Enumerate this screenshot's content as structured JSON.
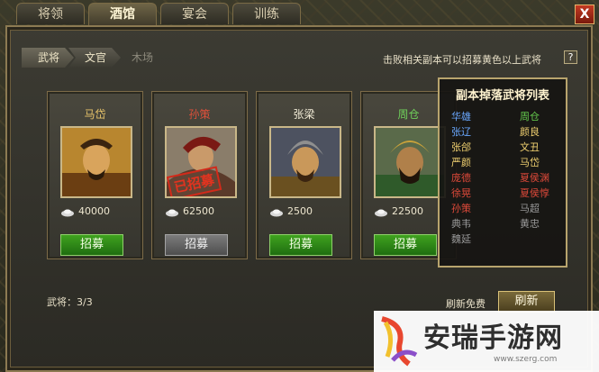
{
  "tabs": [
    {
      "label": "将领",
      "active": false
    },
    {
      "label": "酒馆",
      "active": true
    },
    {
      "label": "宴会",
      "active": false
    },
    {
      "label": "训练",
      "active": false
    }
  ],
  "close_label": "X",
  "breadcrumb": [
    "武将",
    "文官",
    "木场"
  ],
  "hint": "击败相关副本可以招募黄色以上武将",
  "help_label": "?",
  "cards": [
    {
      "name": "马岱",
      "name_color": "#e8c46a",
      "cost": "40000",
      "button": "招募",
      "button_state": "enabled",
      "stamp": ""
    },
    {
      "name": "孙策",
      "name_color": "#e0503a",
      "cost": "62500",
      "button": "招募",
      "button_state": "disabled",
      "stamp": "已招募"
    },
    {
      "name": "张梁",
      "name_color": "#f0ead5",
      "cost": "2500",
      "button": "招募",
      "button_state": "enabled",
      "stamp": ""
    },
    {
      "name": "周仓",
      "name_color": "#6fd05a",
      "cost": "22500",
      "button": "招募",
      "button_state": "enabled",
      "stamp": ""
    }
  ],
  "droplist": {
    "title": "副本掉落武将列表",
    "rows": [
      [
        {
          "name": "华雄",
          "color": "#6aa8ff"
        },
        {
          "name": "周仓",
          "color": "#67d04f"
        }
      ],
      [
        {
          "name": "张辽",
          "color": "#6aa8ff"
        },
        {
          "name": "颜良",
          "color": "#f0d070"
        }
      ],
      [
        {
          "name": "张郃",
          "color": "#f0d070"
        },
        {
          "name": "文丑",
          "color": "#f0d070"
        }
      ],
      [
        {
          "name": "严颜",
          "color": "#f0d070"
        },
        {
          "name": "马岱",
          "color": "#f0d070"
        }
      ],
      [
        {
          "name": "庞德",
          "color": "#e04a3a"
        },
        {
          "name": "夏侯渊",
          "color": "#e04a3a"
        }
      ],
      [
        {
          "name": "徐晃",
          "color": "#e04a3a"
        },
        {
          "name": "夏侯惇",
          "color": "#e04a3a"
        }
      ],
      [
        {
          "name": "孙策",
          "color": "#e04a3a"
        },
        {
          "name": "马超",
          "color": "#9a9a9a"
        }
      ],
      [
        {
          "name": "典韦",
          "color": "#9a9a9a"
        },
        {
          "name": "黄忠",
          "color": "#9a9a9a"
        }
      ],
      [
        {
          "name": "魏延",
          "color": "#9a9a9a"
        },
        {
          "name": "",
          "color": "#9a9a9a"
        }
      ]
    ]
  },
  "general_count": "武将：3/3",
  "refresh_label": "刷新免费",
  "refresh_button": "刷新",
  "watermark": {
    "text": "安瑞手游网",
    "url": "www.szerg.com"
  }
}
